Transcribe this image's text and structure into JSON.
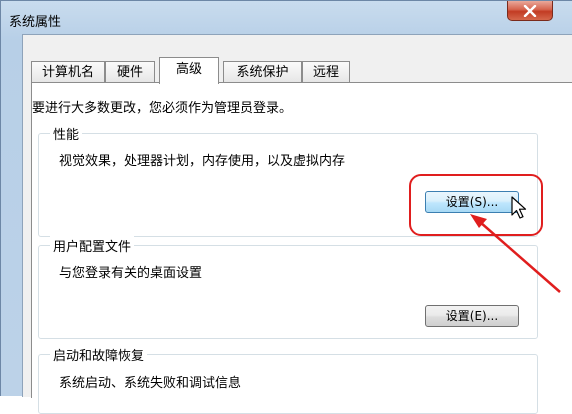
{
  "window": {
    "title": "系统属性"
  },
  "tabs": [
    {
      "label": "计算机名"
    },
    {
      "label": "硬件"
    },
    {
      "label": "高级",
      "active": true
    },
    {
      "label": "系统保护"
    },
    {
      "label": "远程"
    }
  ],
  "admin_note": "要进行大多数更改，您必须作为管理员登录。",
  "performance": {
    "label": "性能",
    "description": "视觉效果，处理器计划，内存使用，以及虚拟内存",
    "button": "设置(S)..."
  },
  "user_profiles": {
    "label": "用户配置文件",
    "description": "与您登录有关的桌面设置",
    "button": "设置(E)..."
  },
  "startup_recovery": {
    "label": "启动和故障恢复",
    "description": "系统启动、系统失败和调试信息"
  },
  "annotation_color": "#e01e1e",
  "icons": [
    "close-icon",
    "mouse-cursor-icon",
    "annotation-arrow"
  ]
}
